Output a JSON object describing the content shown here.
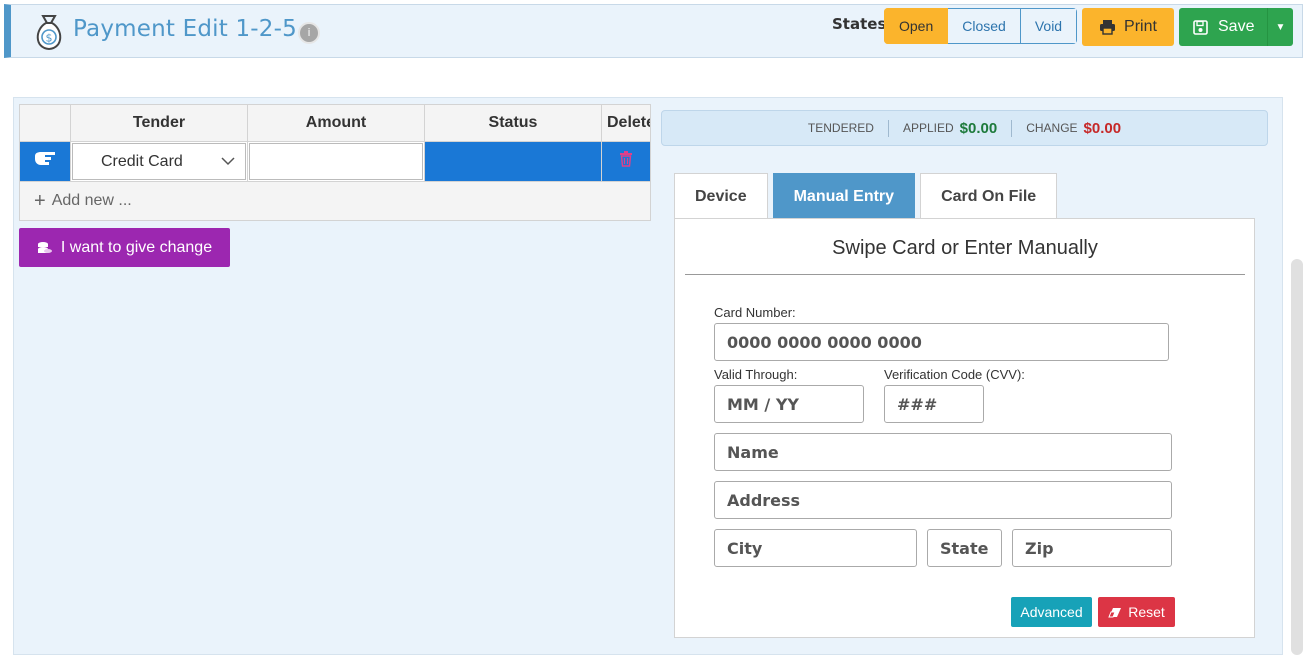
{
  "header": {
    "title": "Payment Edit 1-2-5",
    "states_label": "States:",
    "states": [
      "Open",
      "Closed",
      "Void"
    ],
    "active_state": "Open",
    "print_label": "Print",
    "save_label": "Save"
  },
  "tender_table": {
    "columns": [
      "Tender",
      "Amount",
      "Status",
      "Delete"
    ],
    "rows": [
      {
        "tender": "Credit Card",
        "amount": "",
        "status": ""
      }
    ],
    "add_new": "Add new ..."
  },
  "give_change_label": "I want to give change",
  "summary": {
    "tendered_label": "TENDERED",
    "applied_label": "APPLIED",
    "applied_value": "$0.00",
    "change_label": "CHANGE",
    "change_value": "$0.00"
  },
  "tabs": [
    "Device",
    "Manual Entry",
    "Card On File"
  ],
  "active_tab": "Manual Entry",
  "card_form": {
    "heading": "Swipe Card or Enter Manually",
    "card_number_label": "Card Number:",
    "card_number_placeholder": "0000 0000 0000 0000",
    "valid_through_label": "Valid Through:",
    "valid_through_placeholder": "MM / YY",
    "cvv_label": "Verification Code (CVV):",
    "cvv_placeholder": "###",
    "name_placeholder": "Name",
    "address_placeholder": "Address",
    "city_placeholder": "City",
    "state_placeholder": "State",
    "zip_placeholder": "Zip",
    "advanced_label": "Advanced",
    "reset_label": "Reset"
  },
  "colors": {
    "accent": "#4f97c9",
    "open_state": "#fbb42c",
    "save": "#2ea44f",
    "selected_row": "#1a78d6",
    "give_change": "#9c27b0",
    "advanced": "#17a2b8",
    "reset": "#dc3545"
  },
  "icons": [
    "money-bag-icon",
    "info-icon",
    "printer-icon",
    "floppy-disk-icon",
    "caret-down-icon",
    "hand-pointer-icon",
    "trash-icon",
    "plus-icon",
    "coins-icon",
    "eraser-icon",
    "chevron-down-icon"
  ]
}
